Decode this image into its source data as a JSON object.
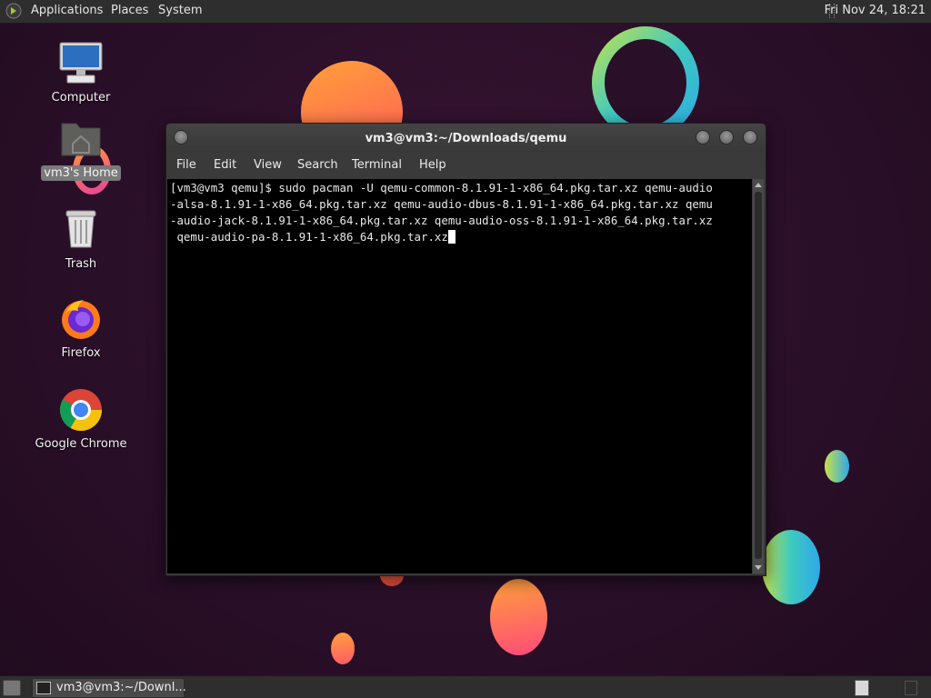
{
  "top_panel": {
    "menus": [
      "Applications",
      "Places",
      "System"
    ],
    "clock": "Fri Nov 24, 18:21"
  },
  "desktop": {
    "icons": [
      {
        "label": "Computer",
        "icon": "computer-icon"
      },
      {
        "label": "vm3's Home",
        "icon": "home-folder-icon",
        "selected": true
      },
      {
        "label": "Trash",
        "icon": "trash-icon"
      },
      {
        "label": "Firefox",
        "icon": "firefox-icon"
      },
      {
        "label": "Google Chrome",
        "icon": "chrome-icon"
      }
    ]
  },
  "terminal": {
    "title": "vm3@vm3:~/Downloads/qemu",
    "menu": [
      "File",
      "Edit",
      "View",
      "Search",
      "Terminal",
      "Help"
    ],
    "lines": [
      "[vm3@vm3 qemu]$ sudo pacman -U qemu-common-8.1.91-1-x86_64.pkg.tar.xz qemu-audio",
      "-alsa-8.1.91-1-x86_64.pkg.tar.xz qemu-audio-dbus-8.1.91-1-x86_64.pkg.tar.xz qemu",
      "-audio-jack-8.1.91-1-x86_64.pkg.tar.xz qemu-audio-oss-8.1.91-1-x86_64.pkg.tar.xz",
      " qemu-audio-pa-8.1.91-1-x86_64.pkg.tar.xz"
    ]
  },
  "bottom_panel": {
    "task_label": "vm3@vm3:~/Downl..."
  },
  "colors": {
    "panel_bg": "#2e2e2e",
    "terminal_bg": "#000000",
    "terminal_fg": "#e8e8e8",
    "desktop_bg": "#2a0f28"
  }
}
